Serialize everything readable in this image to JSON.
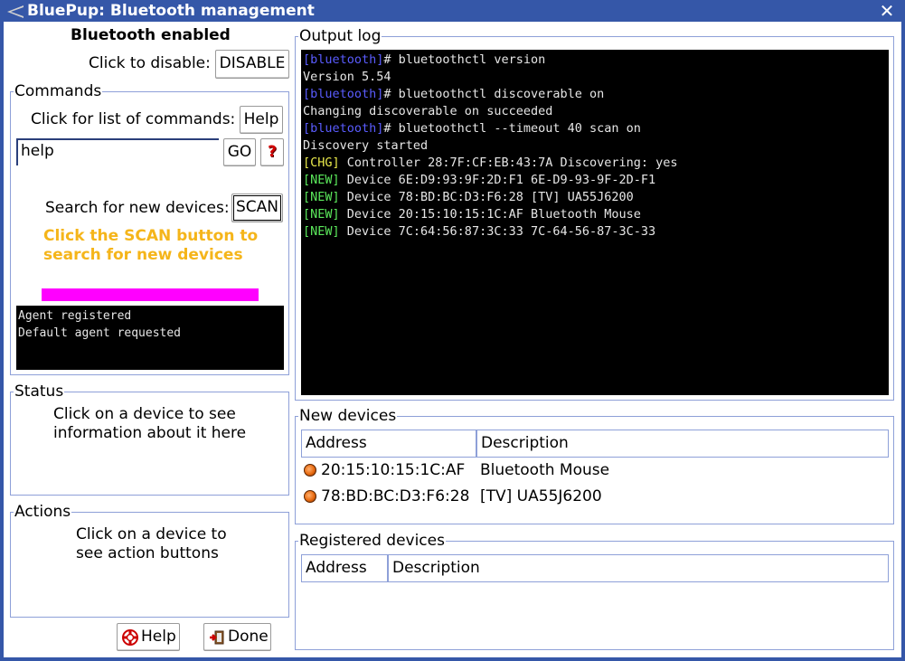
{
  "window": {
    "title": "BluePup: Bluetooth management",
    "close_glyph": "✕"
  },
  "bt": {
    "status": "Bluetooth enabled",
    "disable_prompt": "Click to disable:",
    "disable_button": "DISABLE"
  },
  "commands": {
    "label": "Commands",
    "list_prompt": "Click for list of commands:",
    "help_button": "Help",
    "input_value": "help",
    "go_button": "GO",
    "question_button": "?",
    "scan_prompt": "Search for new devices:",
    "scan_button": "SCAN",
    "scan_hint_1": "Click the SCAN button to",
    "scan_hint_2": "search for new devices",
    "agent_lines": [
      "Agent registered",
      "Default agent requested"
    ],
    "accent_color": "#f5b51a",
    "bar_color": "#ff00ff"
  },
  "status": {
    "label": "Status",
    "line1": "Click on a device to see",
    "line2": "information about it here"
  },
  "actions": {
    "label": "Actions",
    "line1": "Click on a device to",
    "line2": "see action buttons"
  },
  "footer": {
    "help_button": "Help",
    "done_button": "Done"
  },
  "output": {
    "label": "Output log",
    "lines": [
      {
        "tag": "[bluetooth]",
        "tag_color": "blue",
        "text": "# bluetoothctl version"
      },
      {
        "tag": "",
        "tag_color": "",
        "text": "Version 5.54"
      },
      {
        "tag": "[bluetooth]",
        "tag_color": "blue",
        "text": "# bluetoothctl discoverable on"
      },
      {
        "tag": "",
        "tag_color": "",
        "text": "Changing discoverable on succeeded"
      },
      {
        "tag": "[bluetooth]",
        "tag_color": "blue",
        "text": "# bluetoothctl --timeout 40 scan on"
      },
      {
        "tag": "",
        "tag_color": "",
        "text": "Discovery started"
      },
      {
        "tag": "[CHG]",
        "tag_color": "yellow",
        "text": " Controller 28:7F:CF:EB:43:7A Discovering: yes"
      },
      {
        "tag": "[NEW]",
        "tag_color": "green",
        "text": " Device 6E:D9:93:9F:2D:F1 6E-D9-93-9F-2D-F1"
      },
      {
        "tag": "[NEW]",
        "tag_color": "green",
        "text": " Device 78:BD:BC:D3:F6:28 [TV] UA55J6200"
      },
      {
        "tag": "[NEW]",
        "tag_color": "green",
        "text": " Device 20:15:10:15:1C:AF Bluetooth Mouse"
      },
      {
        "tag": "[NEW]",
        "tag_color": "green",
        "text": " Device 7C:64:56:87:3C:33 7C-64-56-87-3C-33"
      }
    ]
  },
  "new_devices": {
    "label": "New devices",
    "columns": [
      "Address",
      "Description"
    ],
    "rows": [
      {
        "address": "20:15:10:15:1C:AF",
        "description": "Bluetooth Mouse"
      },
      {
        "address": "78:BD:BC:D3:F6:28",
        "description": "[TV] UA55J6200"
      }
    ]
  },
  "registered_devices": {
    "label": "Registered devices",
    "columns": [
      "Address",
      "Description"
    ],
    "rows": []
  }
}
